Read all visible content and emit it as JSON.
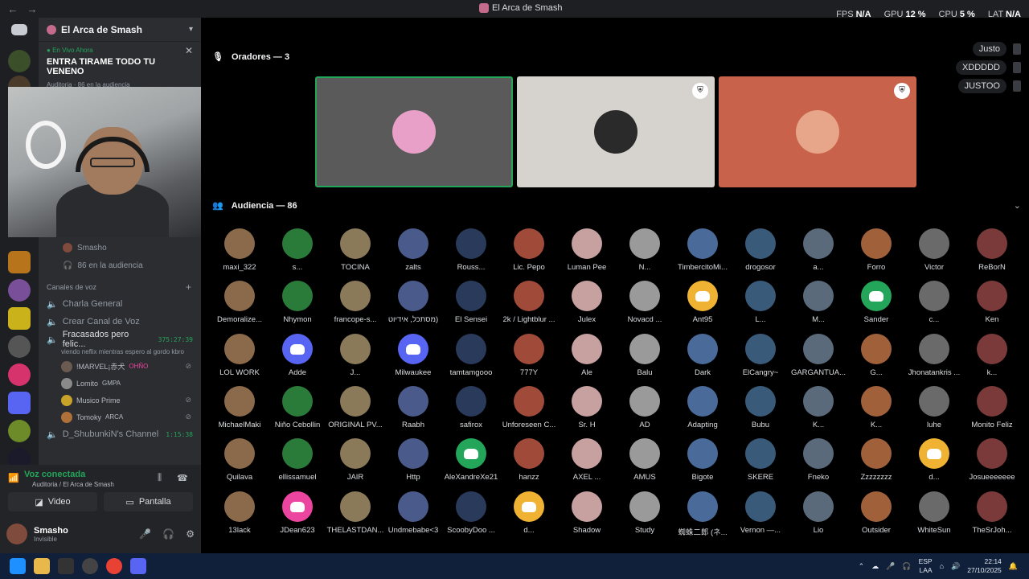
{
  "window": {
    "title": "El Arca de Smash"
  },
  "perf": {
    "fps_label": "FPS",
    "fps": "N/A",
    "gpu_label": "GPU",
    "gpu": "12 %",
    "cpu_label": "CPU",
    "cpu": "5 %",
    "lat_label": "LAT",
    "lat": "N/A"
  },
  "server": {
    "name": "El Arca de Smash"
  },
  "live": {
    "tag": "En Vivo Ahora",
    "title": "ENTRA TIRAME TODO TU VENENO",
    "meta": "Auditoria · 86 en la audiencia"
  },
  "stage_info": {
    "speaker": "Smasho",
    "audience": "86 en la audiencia"
  },
  "voice_category": "Canales de voz",
  "voice_channels": [
    {
      "name": "Charla General",
      "time": ""
    },
    {
      "name": "Crear Canal de Voz",
      "time": ""
    },
    {
      "name": "Fracasados pero felic...",
      "time": "375:27:39"
    }
  ],
  "voice_status": "viendo neflix mientras espero al gordo kbro",
  "voice_users": [
    {
      "name": "!MARVEL¡赤犬",
      "tag": "OHÑO"
    },
    {
      "name": "Lomito",
      "tag": "GMPA"
    },
    {
      "name": "Musico Prime",
      "tag": ""
    },
    {
      "name": "Tomoky",
      "tag": "ARCA"
    }
  ],
  "other_channel": {
    "name": "D_ShubunkiN's Channel",
    "time": "1:15:38"
  },
  "connection": {
    "status": "Voz conectada",
    "location": "Auditoria / El Arca de Smash"
  },
  "buttons": {
    "video": "Video",
    "screen": "Pantalla"
  },
  "user": {
    "name": "Smasho",
    "status": "Invisible"
  },
  "speakers_header": "Oradores — 3",
  "audience_header": "Audiencia — 86",
  "name_bubbles": [
    "Justo",
    "XDDDDD",
    "JUSTOO"
  ],
  "audience": [
    "maxi_322",
    "s...",
    "TOCINA",
    "zalts",
    "Rouss...",
    "Lic. Pepo",
    "Luman Pee",
    "N...",
    "TimbercitoMi...",
    "drogosor",
    "a...",
    "Forro",
    "Victor",
    "ReBorN",
    "Demoralize...",
    "Nhymon",
    "francope-s...",
    "מסתכל, אידיוט)",
    "El Sensei",
    "2k / Lightblur ...",
    "Julex",
    "Novacd ...",
    "Ant95",
    "L...",
    "M...",
    "Sander",
    "c...",
    "Ken",
    "LOL WORK",
    "Adde",
    "J...",
    "Milwaukee",
    "tamtamgooo",
    "777Y",
    "Ale",
    "Balu",
    "Dark",
    "ElCangry~",
    "GARGANTUA...",
    "G...",
    "Jhonatankris ...",
    "k...",
    "MichaelMaki",
    "Niño Cebollin",
    "ORIGINAL PV...",
    "Raabh",
    "safirox",
    "Unforeseen C...",
    "Sr. H",
    "AD",
    "Adapting",
    "Bubu",
    "K...",
    "K...",
    "luhe",
    "Monito Feliz",
    "Quilava",
    "ellissamuel",
    "JAIR",
    "Http",
    "AleXandreXe21",
    "hanzz",
    "AXEL ...",
    "AMUS",
    "Bigote",
    "SKERE",
    "Fneko",
    "Zzzzzzzz",
    "d...",
    "Josueeeeeee",
    "13lack",
    "JDean623",
    "THELASTDAN...",
    "Undmebabe<3",
    "ScoobyDoo ...",
    "d...",
    "Shadow",
    "Study",
    "蜘蛛二郎 (ネ...",
    "Vernon —...",
    "Lio",
    "Outsider",
    "WhiteSun",
    "TheSrJoh..."
  ],
  "taskbar": {
    "lang": "ESP",
    "layout": "LAA",
    "time": "22:14",
    "date": "27/10/2025"
  }
}
